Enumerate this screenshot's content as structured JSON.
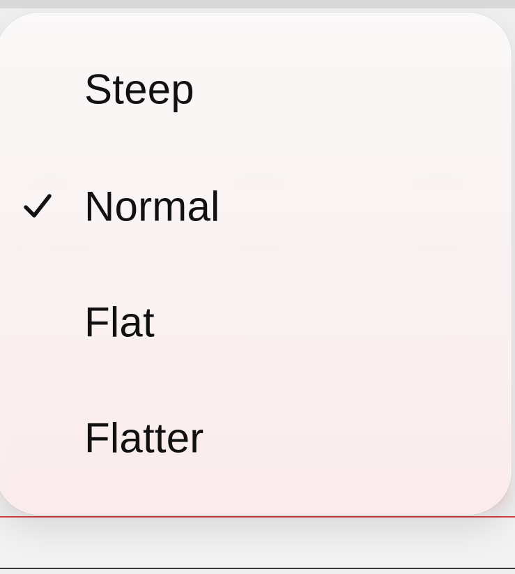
{
  "menu": {
    "items": [
      {
        "label": "Steep",
        "selected": false
      },
      {
        "label": "Normal",
        "selected": true
      },
      {
        "label": "Flat",
        "selected": false
      },
      {
        "label": "Flatter",
        "selected": false
      }
    ]
  },
  "icons": {
    "selected_indicator": "checkmark-icon"
  },
  "colors": {
    "menu_background": "#f9f4f4",
    "text": "#111111",
    "accent_line": "#d23b3b"
  }
}
